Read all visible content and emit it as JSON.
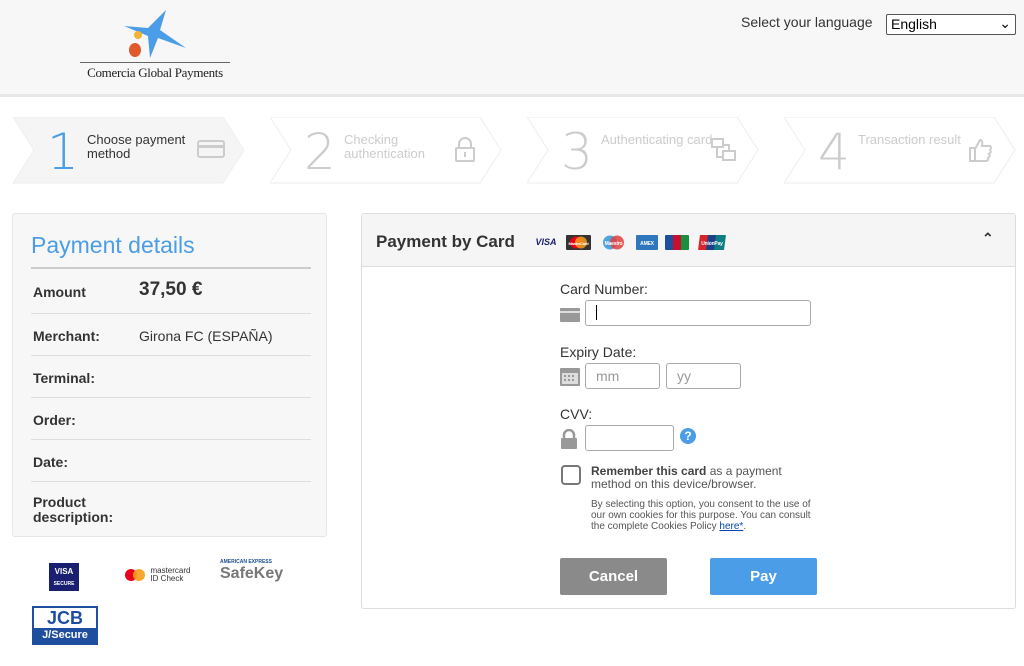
{
  "header": {
    "logo_text": "Comercia Global Payments",
    "language_label": "Select your language",
    "language_value": "English"
  },
  "steps": [
    {
      "number": "1",
      "label": "Choose payment method",
      "icon": "credit-card-icon",
      "active": true
    },
    {
      "number": "2",
      "label": "Checking authentication",
      "icon": "lock-icon",
      "active": false
    },
    {
      "number": "3",
      "label": "Authenticating card",
      "icon": "devices-icon",
      "active": false
    },
    {
      "number": "4",
      "label": "Transaction result",
      "icon": "thumbs-up-icon",
      "active": false
    }
  ],
  "details": {
    "title": "Payment details",
    "rows": [
      {
        "key": "Amount",
        "value": "37,50 €"
      },
      {
        "key": "Merchant:",
        "value": "Girona FC (ESPAÑA)"
      },
      {
        "key": "Terminal:",
        "value": ""
      },
      {
        "key": "Order:",
        "value": ""
      },
      {
        "key": "Date:",
        "value": ""
      },
      {
        "key": "Product description:",
        "value": ""
      }
    ]
  },
  "security_logos": {
    "visa": "VISA",
    "visa_sub": "SECURE",
    "mastercard": "mastercard",
    "mastercard_sub": "ID Check",
    "amex_top": "AMERICAN EXPRESS",
    "amex": "SafeKey",
    "jcb": "JCB",
    "jcb_sub": "J/Secure"
  },
  "card_panel": {
    "title": "Payment by Card",
    "brands": [
      "VISA",
      "MasterCard",
      "Maestro",
      "AMEX",
      "JCB",
      "UnionPay"
    ],
    "card_number_label": "Card Number:",
    "card_number_value": "",
    "expiry_label": "Expiry Date:",
    "mm_placeholder": "mm",
    "yy_placeholder": "yy",
    "cvv_label": "CVV:",
    "cvv_value": "",
    "remember_bold": "Remember this card",
    "remember_rest": " as a payment method on this device/browser.",
    "consent_text": "By selecting this option, you consent to the use of our own cookies for this purpose. You can consult the complete Cookies Policy ",
    "consent_link": "here*",
    "consent_end": ".",
    "cancel_label": "Cancel",
    "pay_label": "Pay"
  },
  "colors": {
    "accent": "#4a9de6",
    "cancel": "#8a8a8a"
  }
}
